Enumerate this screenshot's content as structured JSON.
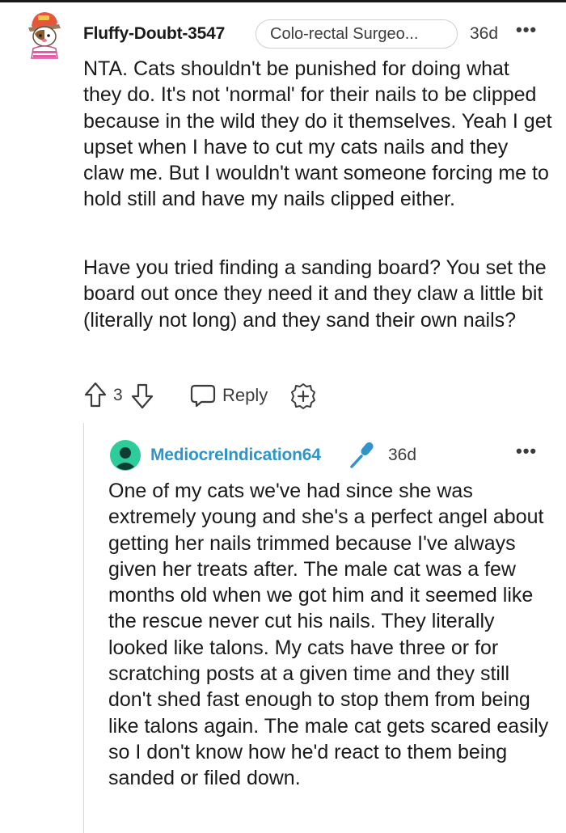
{
  "comment": {
    "username": "Fluffy-Doubt-3547",
    "flair": "Colo-rectal Surgeo...",
    "age": "36d",
    "paragraphs": [
      "NTA. Cats shouldn't be punished for doing what they do. It's not 'normal' for their nails to be clipped because in the wild they do it themselves. Yeah I get upset when I have to cut my cats nails and they claw me. But I wouldn't want someone forcing me to hold still and have my nails clipped either.",
      "Have you tried finding a sanding board? You set the board out once they need it and they claw a little bit (literally not long) and they sand their own nails?"
    ],
    "vote_count": "3",
    "reply_label": "Reply",
    "icons": [
      "avatar",
      "more-options-icon",
      "upvote-icon",
      "downvote-icon",
      "reply-icon",
      "award-icon"
    ]
  },
  "reply": {
    "username": "MediocreIndication64",
    "age": "36d",
    "paragraphs": [
      "One of my cats we've had since she was extremely young and she's a perfect angel about getting her nails trimmed because I've always given her treats after. The male cat was a few months old when we got him and it seemed like the rescue never cut his nails. They literally looked like talons. My cats have three or for scratching posts at a given time and they still don't shed fast enough to stop them from being like talons again. The male cat gets scared easily so I don't know how he'd react to them being sanded or filed down."
    ],
    "icons": [
      "avatar",
      "microphone-icon",
      "more-options-icon"
    ]
  },
  "more_glyph": "•••",
  "colors": {
    "text": "#1a1a1b",
    "meta": "#3c3c3c",
    "reply_username": "#2f94c7",
    "mic_icon": "#2f94c7",
    "avatar_green": "#2ecc9a",
    "thread_line": "#d8d8d8"
  }
}
